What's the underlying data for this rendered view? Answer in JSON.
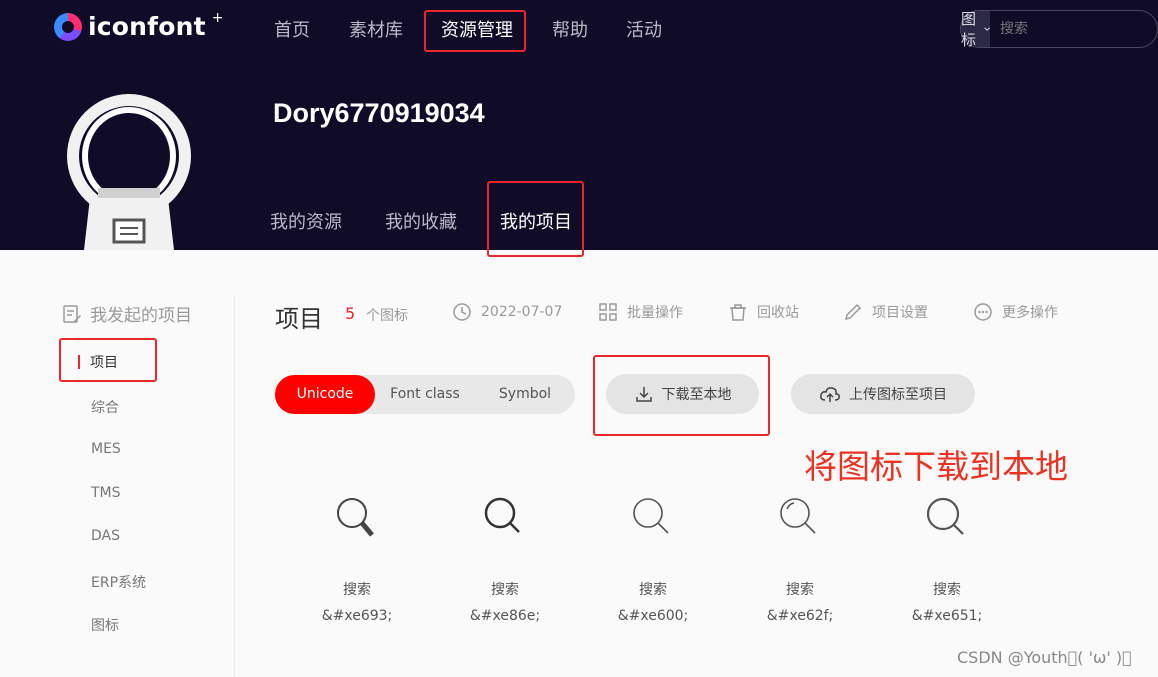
{
  "brand": {
    "name": "iconfont",
    "plus": "+"
  },
  "top_nav": [
    "首页",
    "素材库",
    "资源管理",
    "帮助",
    "活动"
  ],
  "search": {
    "type_label": "图标",
    "placeholder": "搜索"
  },
  "user": {
    "name": "Dory6770919034"
  },
  "sub_tabs": [
    "我的资源",
    "我的收藏",
    "我的项目"
  ],
  "sidebar": {
    "heading": "我发起的项目",
    "items": [
      "项目",
      "综合",
      "MES",
      "TMS",
      "DAS",
      "ERP系统",
      "图标"
    ]
  },
  "project": {
    "title": "项目",
    "count": "5",
    "count_unit": "个图标",
    "date": "2022-07-07",
    "actions": [
      "批量操作",
      "回收站",
      "项目设置",
      "更多操作"
    ]
  },
  "segments": [
    "Unicode",
    "Font class",
    "Symbol"
  ],
  "buttons": {
    "download": "下载至本地",
    "upload": "上传图标至项目"
  },
  "annotation": "将图标下载到本地",
  "icons": [
    {
      "name": "搜索",
      "code": "&#xe693;"
    },
    {
      "name": "搜索",
      "code": "&#xe86e;"
    },
    {
      "name": "搜索",
      "code": "&#xe600;"
    },
    {
      "name": "搜索",
      "code": "&#xe62f;"
    },
    {
      "name": "搜索",
      "code": "&#xe651;"
    }
  ],
  "watermark": "CSDN @Youth\u0000( 'ω' )\u0000",
  "colors": {
    "header_bg": "#100c28",
    "accent_red": "#ff0000",
    "highlight_box": "#e8262b"
  }
}
